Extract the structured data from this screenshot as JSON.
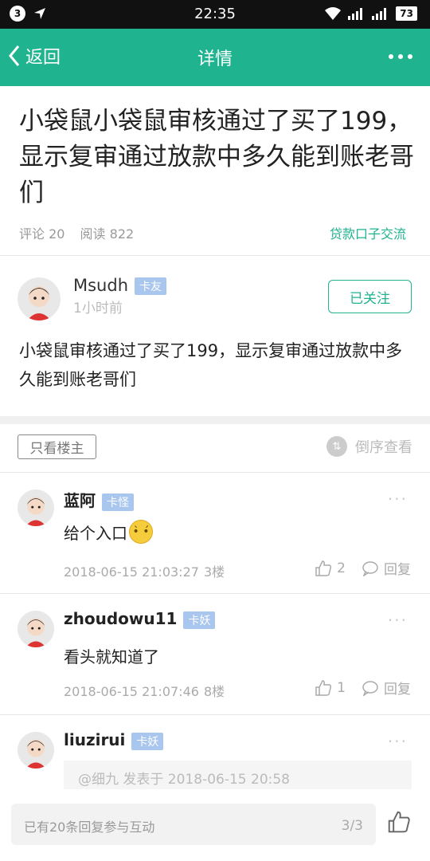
{
  "status_bar": {
    "notification_count": "3",
    "time": "22:35",
    "battery": "73"
  },
  "nav": {
    "back_label": "返回",
    "title": "详情"
  },
  "post": {
    "title": "小袋鼠小袋鼠审核通过了买了199，显示复审通过放款中多久能到账老哥们",
    "comments_label": "评论 20",
    "reads_label": "阅读 822",
    "tag": "贷款口子交流"
  },
  "author": {
    "name": "Msudh",
    "badge": "卡友",
    "time": "1小时前",
    "follow_label": "已关注",
    "body": "小袋鼠审核通过了买了199，显示复审通过放款中多久能到账老哥们"
  },
  "filter": {
    "only_op_label": "只看楼主",
    "reverse_label": "倒序查看"
  },
  "replies": [
    {
      "name": "蓝阿",
      "badge": "卡怪",
      "text": "给个入口",
      "date": "2018-06-15 21:03:27",
      "floor": "3楼",
      "likes": "2",
      "reply_label": "回复"
    },
    {
      "name": "zhoudowu11",
      "badge": "卡妖",
      "text": "看头就知道了",
      "date": "2018-06-15 21:07:46",
      "floor": "8楼",
      "likes": "1",
      "reply_label": "回复"
    },
    {
      "name": "liuzirui",
      "badge": "卡妖",
      "quote": "@细九 发表于 2018-06-15 20:58"
    }
  ],
  "bottom": {
    "placeholder": "已有20条回复参与互动",
    "page": "3/3"
  },
  "colors": {
    "accent": "#1fb38f",
    "badge": "#a9c6ee"
  }
}
